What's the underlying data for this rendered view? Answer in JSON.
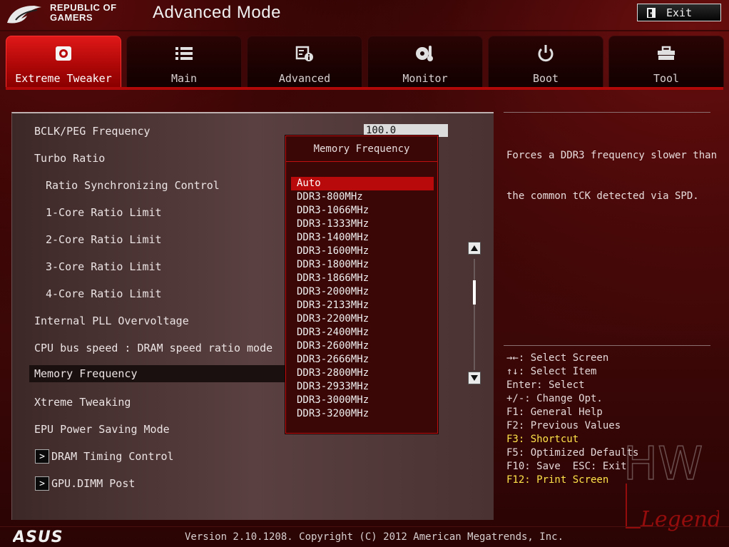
{
  "header": {
    "brand_line1": "REPUBLIC OF",
    "brand_line2": "GAMERS",
    "mode_title": "Advanced Mode",
    "exit_label": "Exit"
  },
  "tabs": [
    {
      "label": "Extreme Tweaker",
      "icon": "memory-chip-icon",
      "active": true
    },
    {
      "label": "Main",
      "icon": "list-icon",
      "active": false
    },
    {
      "label": "Advanced",
      "icon": "advanced-settings-icon",
      "active": false
    },
    {
      "label": "Monitor",
      "icon": "thermometer-fan-icon",
      "active": false
    },
    {
      "label": "Boot",
      "icon": "power-icon",
      "active": false
    },
    {
      "label": "Tool",
      "icon": "toolbox-icon",
      "active": false
    }
  ],
  "settings": {
    "bclk_label": "BCLK/PEG Frequency",
    "bclk_value": "100.0",
    "items": [
      "Turbo Ratio",
      "Ratio Synchronizing Control",
      "1-Core Ratio Limit",
      "2-Core Ratio Limit",
      "3-Core Ratio Limit",
      "4-Core Ratio Limit",
      "Internal PLL Overvoltage",
      "CPU bus speed : DRAM speed ratio mode",
      "Memory Frequency",
      "Xtreme Tweaking",
      "EPU Power Saving Mode",
      "DRAM Timing Control",
      "GPU.DIMM Post"
    ]
  },
  "popup": {
    "title": "Memory Frequency",
    "selected_index": 0,
    "options": [
      "Auto",
      "DDR3-800MHz",
      "DDR3-1066MHz",
      "DDR3-1333MHz",
      "DDR3-1400MHz",
      "DDR3-1600MHz",
      "DDR3-1800MHz",
      "DDR3-1866MHz",
      "DDR3-2000MHz",
      "DDR3-2133MHz",
      "DDR3-2200MHz",
      "DDR3-2400MHz",
      "DDR3-2600MHz",
      "DDR3-2666MHz",
      "DDR3-2800MHz",
      "DDR3-2933MHz",
      "DDR3-3000MHz",
      "DDR3-3200MHz"
    ]
  },
  "help": {
    "line1": "Forces a DDR3 frequency slower than",
    "line2": "the common tCK detected via SPD."
  },
  "keys": [
    {
      "text": "→←: Select Screen",
      "highlight": false
    },
    {
      "text": "↑↓: Select Item",
      "highlight": false
    },
    {
      "text": "Enter: Select",
      "highlight": false
    },
    {
      "text": "+/-: Change Opt.",
      "highlight": false
    },
    {
      "text": "F1: General Help",
      "highlight": false
    },
    {
      "text": "F2: Previous Values",
      "highlight": false
    },
    {
      "text": "F3: Shortcut",
      "highlight": true
    },
    {
      "text": "F5: Optimized Defaults",
      "highlight": false
    },
    {
      "text": "F10: Save  ESC: Exit",
      "highlight": false
    },
    {
      "text": "F12: Print Screen",
      "highlight": true
    }
  ],
  "footer": {
    "brand": "ASUS",
    "version": "Version 2.10.1208. Copyright (C) 2012 American Megatrends, Inc."
  },
  "watermark": {
    "line1": "HW",
    "line2": "Legend"
  },
  "colors": {
    "accent_red": "#b80a0a",
    "highlight_yellow": "#ffe34a"
  }
}
